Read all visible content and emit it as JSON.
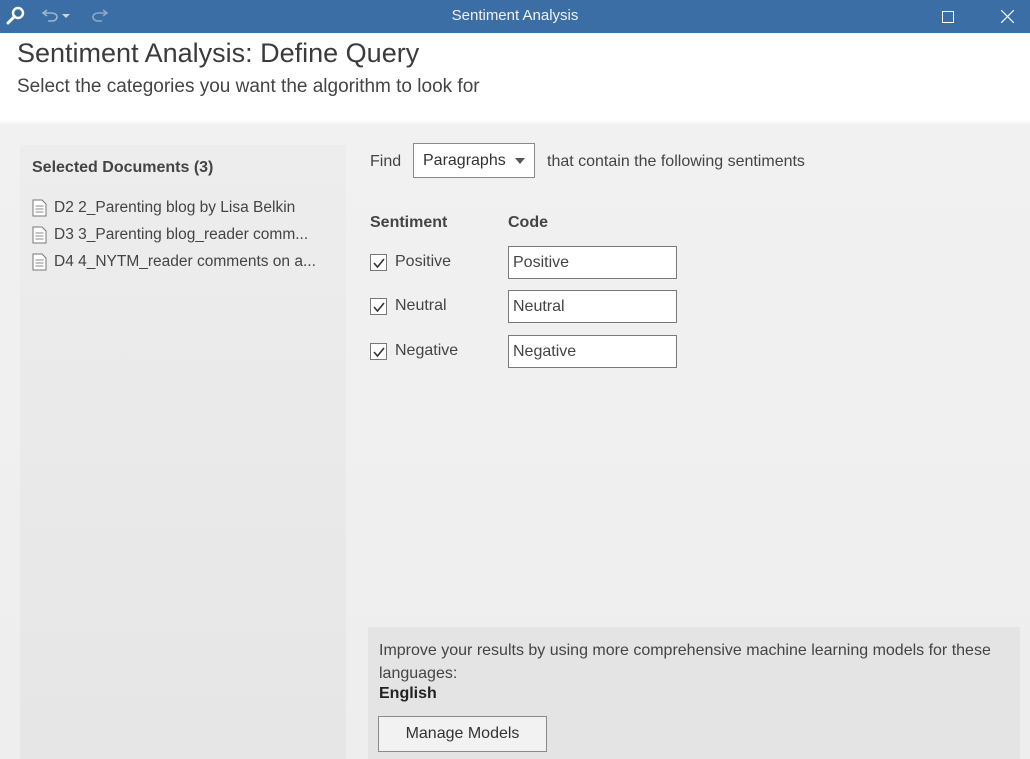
{
  "window": {
    "title": "Sentiment Analysis",
    "icons": {
      "app": "magnifier-icon",
      "undo": "undo-icon",
      "undo_dropdown": "chevron-down-icon",
      "redo": "redo-icon",
      "maximize": "maximize-icon",
      "close": "close-icon"
    }
  },
  "header": {
    "title_main": "Sentiment Analysis:",
    "title_rest": " Define Query",
    "subtitle": "Select the categories you want the algorithm to look for"
  },
  "documents": {
    "heading": "Selected Documents (3)",
    "items": [
      {
        "label": "D2 2_Parenting blog by Lisa Belkin"
      },
      {
        "label": "D3 3_Parenting blog_reader comm..."
      },
      {
        "label": "D4 4_NYTM_reader comments on a..."
      }
    ]
  },
  "query": {
    "find_label": "Find",
    "unit_selected": "Paragraphs",
    "find_suffix": "that contain the following sentiments",
    "col_sentiment": "Sentiment",
    "col_code": "Code",
    "sentiments": [
      {
        "label": "Positive",
        "checked": true,
        "code": "Positive"
      },
      {
        "label": "Neutral",
        "checked": true,
        "code": "Neutral"
      },
      {
        "label": "Negative",
        "checked": true,
        "code": "Negative"
      }
    ]
  },
  "models": {
    "info": "Improve your results by using more comprehensive machine learning models for these languages:",
    "language": "English",
    "button": "Manage Models"
  },
  "colors": {
    "titlebar": "#3a6ea5",
    "panel": "#e8e8e8"
  }
}
